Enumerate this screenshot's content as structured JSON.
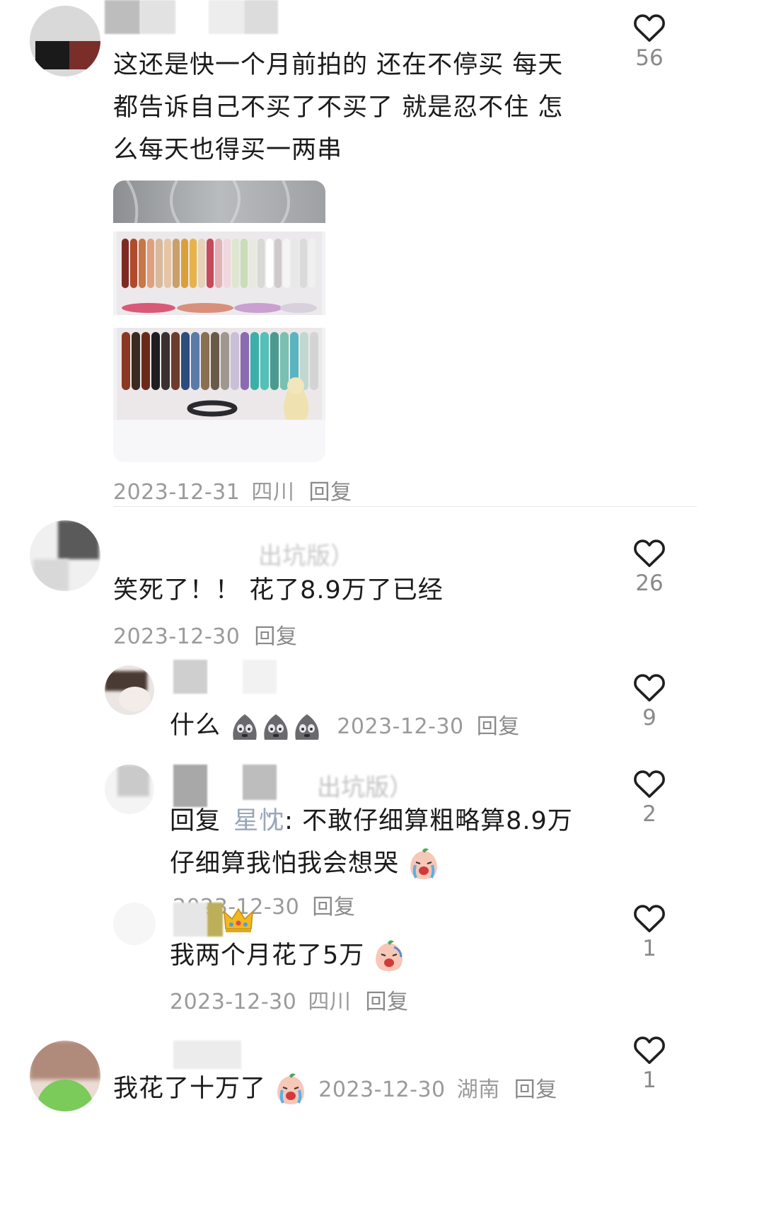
{
  "comments": [
    {
      "text": "这还是快一个月前拍的 还在不停买 每天都告诉自己不买了不买了 就是忍不住 怎么每天也得买一两串",
      "date": "2023-12-31",
      "location": "四川",
      "reply_label": "回复",
      "likes": "56"
    },
    {
      "username_partial": "出坑版）",
      "text": "笑死了！！ 花了8.9万了已经",
      "date": "2023-12-30",
      "reply_label": "回复",
      "likes": "26",
      "replies": [
        {
          "text": "什么",
          "emoji": "sweat-face-emoji",
          "date": "2023-12-30",
          "reply_label": "回复",
          "likes": "9"
        },
        {
          "username_partial": "出坑版）",
          "reply_prefix": "回复",
          "mention": "星忱",
          "text": ": 不敢仔细算粗略算8.9万仔细算我怕我会想哭",
          "emoji": "crying-face-emoji",
          "date": "2023-12-30",
          "reply_label": "回复",
          "likes": "2"
        },
        {
          "badge": "crown-badge",
          "text": "我两个月花了5万",
          "emoji": "crying-face-emoji",
          "date": "2023-12-30",
          "location": "四川",
          "reply_label": "回复",
          "likes": "1"
        }
      ]
    },
    {
      "text": "我花了十万了",
      "emoji": "crying-face-emoji",
      "date": "2023-12-30",
      "location": "湖南",
      "reply_label": "回复",
      "likes": "1"
    }
  ],
  "colors": {
    "heart": "#1f1f1f",
    "meta": "#9a9a9a",
    "mention": "#9aa6b8"
  }
}
